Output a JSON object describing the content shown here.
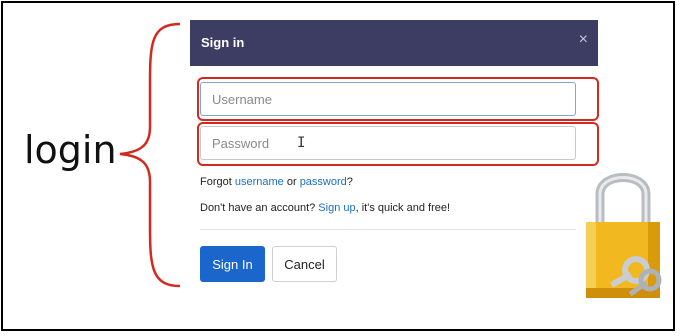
{
  "annotation": {
    "label": "login",
    "accent_color": "#d22a1f"
  },
  "dialog": {
    "title": "Sign in",
    "close_symbol": "×",
    "header_color": "#3d3d63",
    "username": {
      "placeholder": "Username",
      "value": ""
    },
    "password": {
      "placeholder": "Password",
      "value": ""
    },
    "forgot": {
      "prefix": "Forgot ",
      "username_link": "username",
      "middle": " or ",
      "password_link": "password",
      "suffix": "?"
    },
    "signup": {
      "prefix": "Don't have an account? ",
      "link": "Sign up",
      "suffix": ", it's quick and free!"
    },
    "buttons": {
      "sign_in": "Sign In",
      "cancel": "Cancel"
    },
    "primary_color": "#1b66cc"
  },
  "icons": {
    "lock": "padlock-with-keys-icon",
    "cursor": "text-cursor-icon"
  }
}
